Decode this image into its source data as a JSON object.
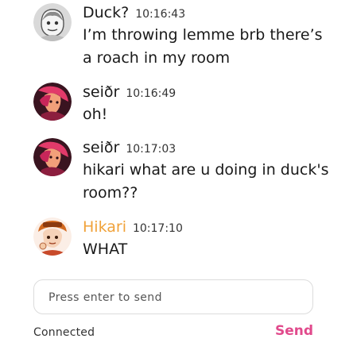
{
  "messages": [
    {
      "author": "Duck?",
      "time": "10:16:43",
      "text": "I’m throwing lemme brb there’s a roach in my room",
      "avatar": "sketch-face-avatar",
      "name_color": "#1a1a1a"
    },
    {
      "author": "seiðr",
      "time": "10:16:49",
      "text": "oh!",
      "avatar": "pink-character-avatar",
      "name_color": "#1a1a1a"
    },
    {
      "author": "seiðr",
      "time": "10:17:03",
      "text": "hikari what are u doing in duck's room??",
      "avatar": "pink-character-avatar",
      "name_color": "#1a1a1a"
    },
    {
      "author": "Hikari",
      "time": "10:17:10",
      "text": "WHAT",
      "avatar": "orange-hat-character-avatar",
      "name_color": "#f0a23a"
    }
  ],
  "composer": {
    "placeholder": "Press enter to send"
  },
  "footer": {
    "status": "Connected",
    "send_label": "Send",
    "send_color": "#e14a8c"
  }
}
